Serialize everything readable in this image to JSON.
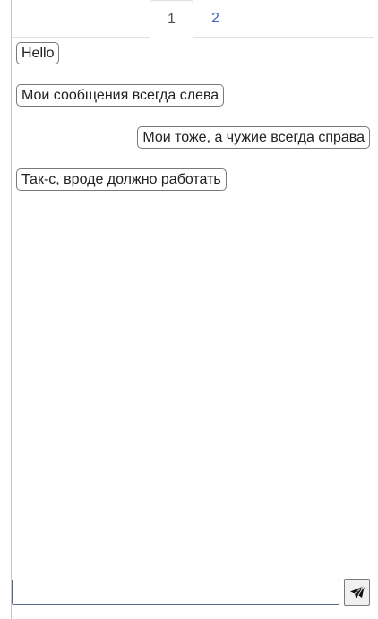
{
  "tabs": [
    {
      "label": "1",
      "active": true
    },
    {
      "label": "2",
      "active": false
    }
  ],
  "messages": [
    {
      "text": "Hello",
      "side": "left"
    },
    {
      "text": "Мои сообщения всегда слева",
      "side": "left"
    },
    {
      "text": "Мои тоже, а чужие всегда справа",
      "side": "right"
    },
    {
      "text": "Так-с, вроде должно работать",
      "side": "left"
    }
  ],
  "composer": {
    "input_value": "",
    "send_icon": "send-icon"
  },
  "colors": {
    "active_tab_text": "#495057",
    "inactive_tab_text": "#3b63c9",
    "bubble_border": "#7a7a7a",
    "input_border": "#5a6a90"
  }
}
